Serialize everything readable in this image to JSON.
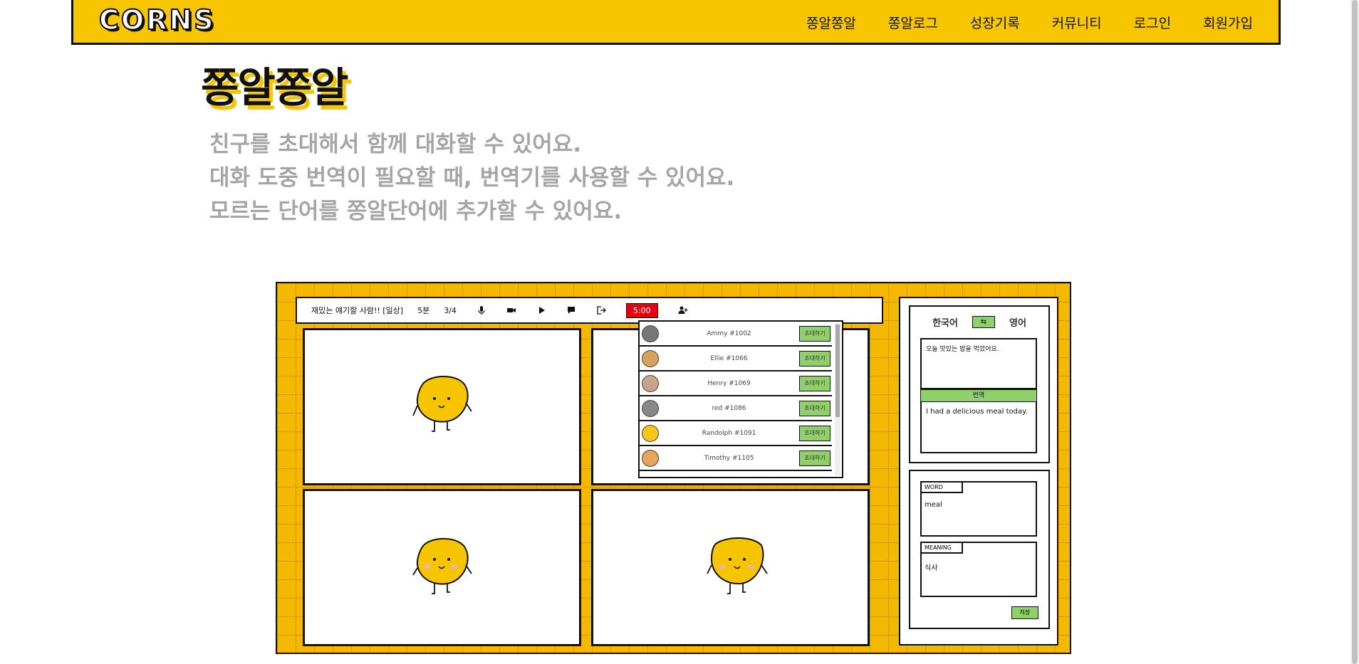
{
  "nav": {
    "logo": "CORNS",
    "items": [
      "쫑알쫑알",
      "쫑알로그",
      "성장기록",
      "커뮤니티",
      "로그인",
      "회원가입"
    ]
  },
  "page_title": "쫑알쫑알",
  "description": [
    "친구를 초대해서 함께 대화할 수 있어요.",
    "대화 도중 번역이 필요할 때, 번역기를 사용할 수 있어요.",
    "모르는 단어를 쫑알단어에 추가할 수 있어요."
  ],
  "toolbar": {
    "room_name": "재밌는 얘기할 사람!! [일상]",
    "duration": "5분",
    "participants": "3/4",
    "timer": "5:00"
  },
  "friends": [
    {
      "name": "Ammy #1002",
      "invite": "초대하기",
      "avatar_color": "#777777"
    },
    {
      "name": "Ellie #1066",
      "invite": "초대하기",
      "avatar_color": "#d9a25a"
    },
    {
      "name": "Henry #1069",
      "invite": "초대하기",
      "avatar_color": "#c9a48a"
    },
    {
      "name": "red #1086",
      "invite": "초대하기",
      "avatar_color": "#888888"
    },
    {
      "name": "Randolph #1091",
      "invite": "초대하기",
      "avatar_color": "#f5c518"
    },
    {
      "name": "Timothy #1105",
      "invite": "초대하기",
      "avatar_color": "#e8a45a"
    }
  ],
  "translator": {
    "source_lang": "한국어",
    "target_lang": "영어",
    "swap_icon": "swap-arrows-icon",
    "source_text": "오늘 맛있는 밥을 먹었어요.",
    "translate_button": "번역",
    "result_text": "I had a delicious meal today."
  },
  "vocab": {
    "word_label": "WORD",
    "word_value": "meal",
    "meaning_label": "MEANING",
    "meaning_value": "식사",
    "save_button": "저장"
  },
  "colors": {
    "brand_yellow": "#f8c600",
    "accent_green": "#8fd06a",
    "timer_red": "#e60012"
  }
}
